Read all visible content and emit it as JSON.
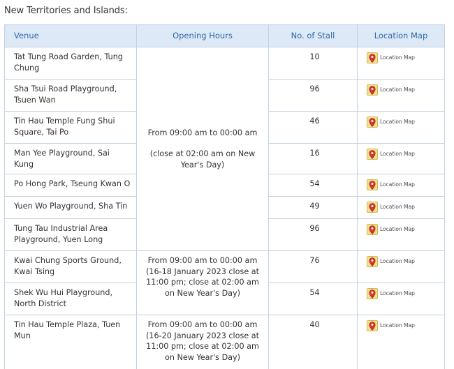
{
  "section_title": "New Territories and Islands:",
  "columns": {
    "venue": "Venue",
    "hours": "Opening Hours",
    "stalls": "No. of Stall",
    "map": "Location Map"
  },
  "location_map_label": "Location Map",
  "hours_groups": [
    {
      "line1": "From 09:00 am to 00:00 am",
      "line2": "(close at 02:00 am on New Year's Day)"
    },
    {
      "line1": "From 09:00 am to 00:00 am (16-18 January 2023 close at 11:00 pm; close at 02:00 am on New Year's Day)"
    },
    {
      "line1": "From 09:00 am to 00:00 am (16-20 January 2023 close at 11:00 pm; close at 02:00 am on New Year's Day)"
    }
  ],
  "rows": [
    {
      "venue": "Tat Tung Road Garden, Tung Chung",
      "stalls": "10"
    },
    {
      "venue": "Sha Tsui Road Playground, Tsuen Wan",
      "stalls": "96"
    },
    {
      "venue": "Tin Hau Temple Fung Shui Square, Tai Po",
      "stalls": "46"
    },
    {
      "venue": "Man Yee Playground, Sai Kung",
      "stalls": "16"
    },
    {
      "venue": "Po Hong Park, Tseung Kwan O",
      "stalls": "54"
    },
    {
      "venue": "Yuen Wo Playground, Sha Tin",
      "stalls": "49"
    },
    {
      "venue": "Tung Tau Industrial Area Playground, Yuen Long",
      "stalls": "96"
    },
    {
      "venue": "Kwai Chung Sports Ground, Kwai Tsing",
      "stalls": "76"
    },
    {
      "venue": "Shek Wu Hui Playground, North District",
      "stalls": "54"
    },
    {
      "venue": "Tin Hau Temple Plaza, Tuen Mun",
      "stalls": "40"
    }
  ],
  "icons": {
    "location": "map-pin-icon"
  },
  "colors": {
    "header_bg": "#dde9f7",
    "header_text": "#2e6aa3",
    "border": "#c4d1df",
    "pin_red": "#d9332b",
    "pin_bg": "#f3e08a"
  }
}
